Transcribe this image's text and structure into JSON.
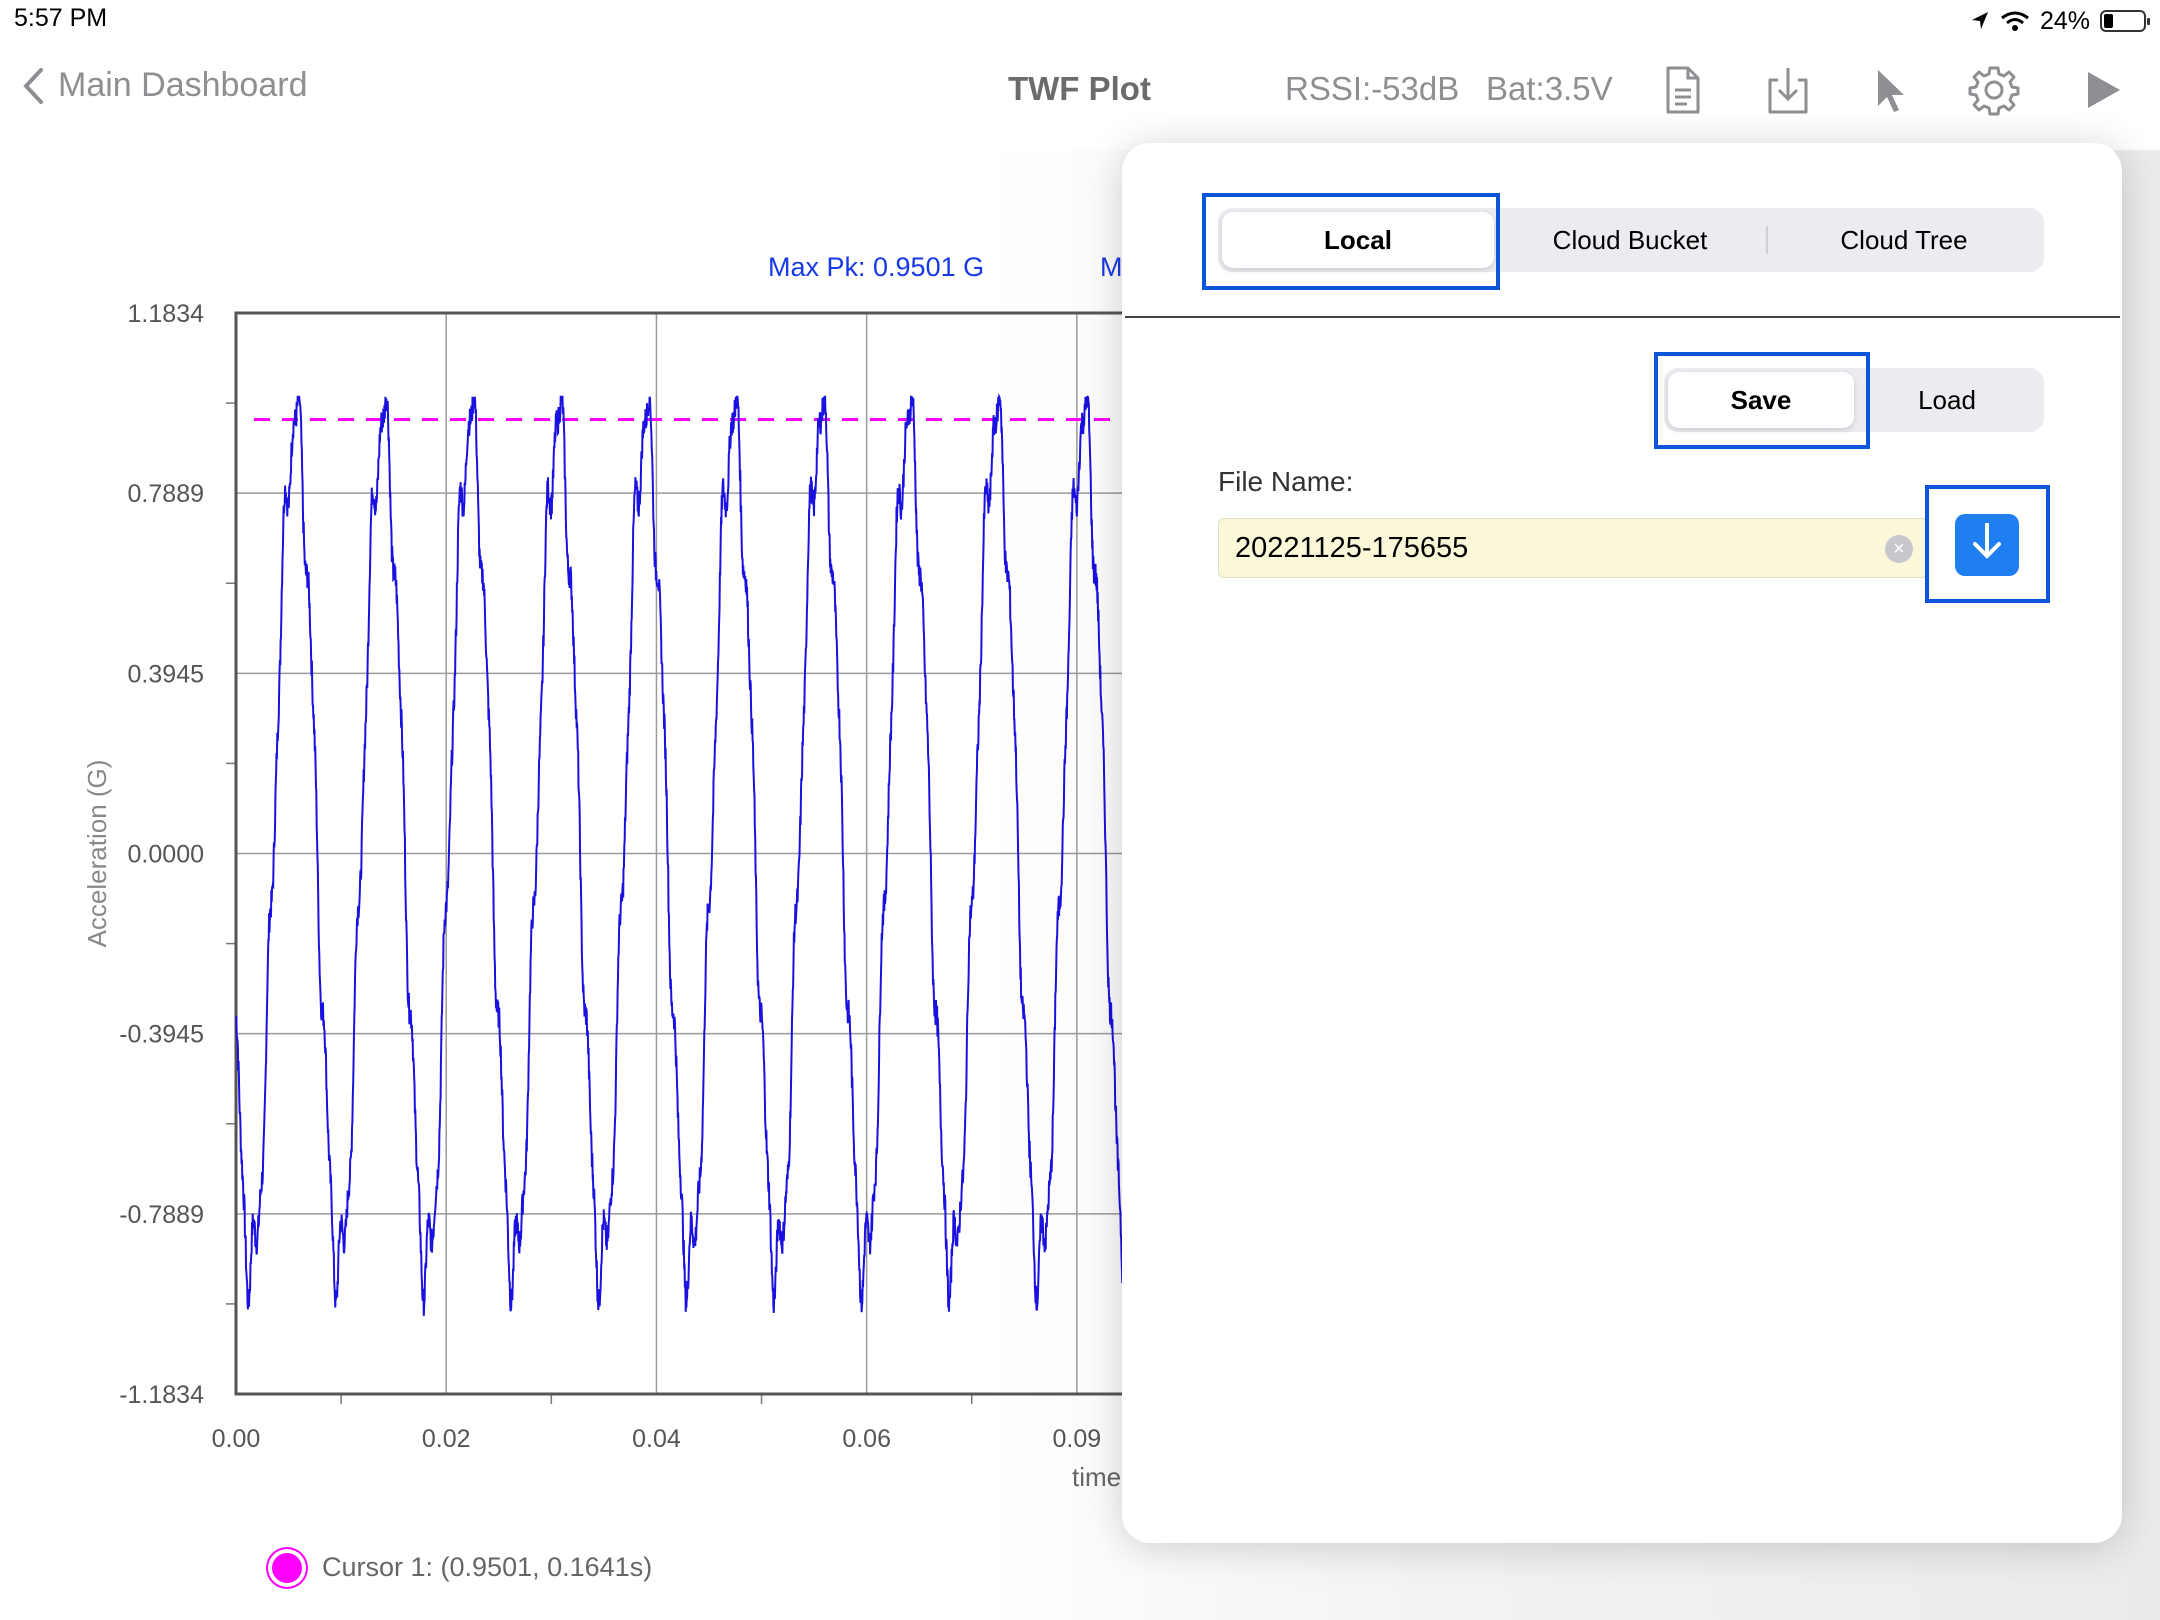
{
  "status_bar": {
    "time": "5:57 PM",
    "battery_percent": "24%",
    "battery_level": 0.24
  },
  "nav": {
    "back_label": "Main Dashboard",
    "title": "TWF Plot",
    "rssi": "RSSI:-53dB",
    "battery": "Bat:3.5V",
    "icons": [
      "document-icon",
      "download-tray-icon",
      "cursor-pointer-icon",
      "gear-icon",
      "play-icon"
    ]
  },
  "chart": {
    "max_pk_label": "Max Pk: 0.9501 G",
    "second_header_partial": "M",
    "cursor_legend": "Cursor 1: (0.9501, 0.1641s)"
  },
  "chart_data": {
    "type": "line",
    "title": "",
    "xlabel": "time",
    "ylabel": "Acceleration (G)",
    "y_ticks": [
      "1.1834",
      "0.7889",
      "0.3945",
      "0.0000",
      "-0.3945",
      "-0.7889",
      "-1.1834"
    ],
    "x_ticks": [
      "0.00",
      "0.02",
      "0.04",
      "0.06",
      "0.09"
    ],
    "ylim": [
      -1.1834,
      1.1834
    ],
    "xlim": [
      0,
      0.092
    ],
    "grid": true,
    "series": [
      {
        "color": "#1a10e0",
        "approx_frequency_hz": 120,
        "approx_amplitude": 0.93,
        "approx_offset": 0.02
      }
    ],
    "cursor_line": {
      "y": 0.9501,
      "color": "#ff00ff",
      "style": "dashed"
    }
  },
  "popover": {
    "source_tabs": [
      {
        "label": "Local",
        "selected": true
      },
      {
        "label": "Cloud Bucket",
        "selected": false
      },
      {
        "label": "Cloud Tree",
        "selected": false
      }
    ],
    "mode_tabs": [
      {
        "label": "Save",
        "selected": true
      },
      {
        "label": "Load",
        "selected": false
      }
    ],
    "file_name_label": "File Name:",
    "file_name_value": "20221125-175655",
    "accent": "#1f7ef0",
    "highlight_color": "#0a55d8"
  }
}
